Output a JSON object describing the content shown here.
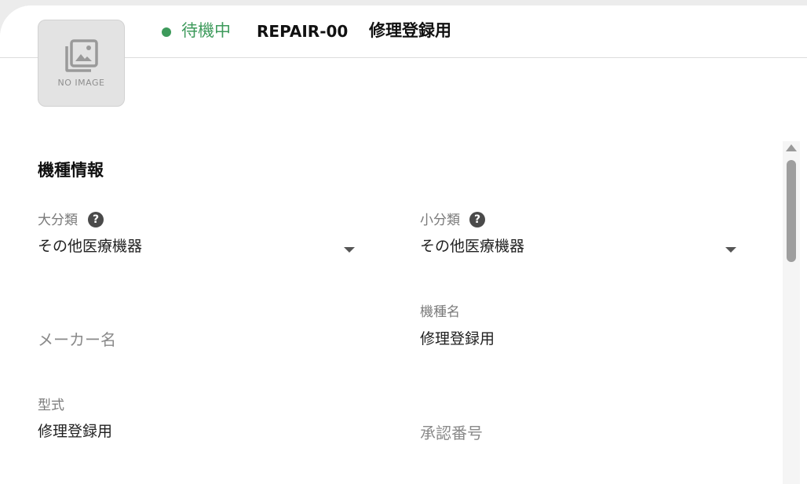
{
  "header": {
    "status": "待機中",
    "status_color": "#3d9a5b",
    "asset_id": "REPAIR-00",
    "asset_name": "修理登録用"
  },
  "thumbnail": {
    "icon": "photo-library-icon",
    "text": "NO IMAGE"
  },
  "section": {
    "title": "機種情報"
  },
  "fields": {
    "major_category": {
      "label": "大分類",
      "value": "その他医療機器",
      "help_icon": "help-icon"
    },
    "minor_category": {
      "label": "小分類",
      "value": "その他医療機器",
      "help_icon": "help-icon"
    },
    "maker_name": {
      "placeholder": "メーカー名"
    },
    "model_name": {
      "label": "機種名",
      "value": "修理登録用"
    },
    "model_type": {
      "label": "型式",
      "value": "修理登録用"
    },
    "approval_number": {
      "placeholder": "承認番号"
    }
  }
}
